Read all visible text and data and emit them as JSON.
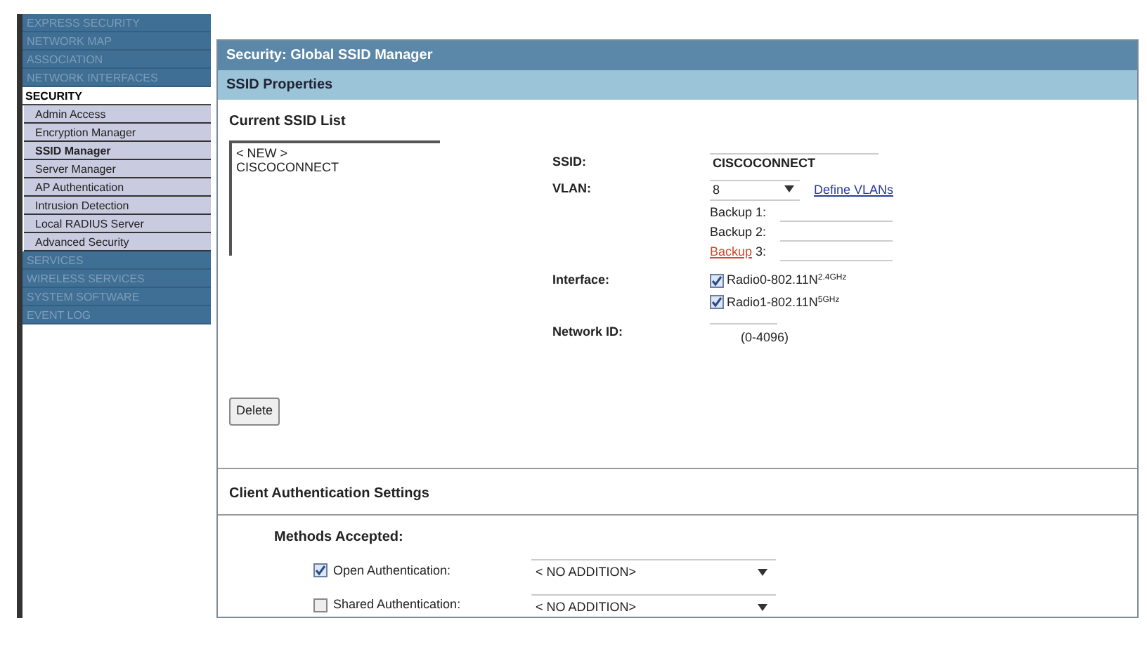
{
  "sidebar": {
    "items": [
      {
        "label": "EXPRESS SECURITY",
        "kind": "section",
        "selected": false
      },
      {
        "label": "NETWORK MAP",
        "kind": "section",
        "selected": false
      },
      {
        "label": "ASSOCIATION",
        "kind": "section",
        "selected": false
      },
      {
        "label": "NETWORK INTERFACES",
        "kind": "section",
        "selected": false
      },
      {
        "label": "SECURITY",
        "kind": "header",
        "selected": false
      },
      {
        "label": "Admin Access",
        "kind": "sub",
        "selected": false
      },
      {
        "label": "Encryption Manager",
        "kind": "sub",
        "selected": false
      },
      {
        "label": "SSID Manager",
        "kind": "sub",
        "selected": true
      },
      {
        "label": "Server Manager",
        "kind": "sub",
        "selected": false
      },
      {
        "label": "AP Authentication",
        "kind": "sub",
        "selected": false
      },
      {
        "label": "Intrusion Detection",
        "kind": "sub",
        "selected": false
      },
      {
        "label": "Local RADIUS Server",
        "kind": "sub",
        "selected": false
      },
      {
        "label": "Advanced Security",
        "kind": "sub",
        "selected": false
      },
      {
        "label": "SERVICES",
        "kind": "section",
        "selected": false
      },
      {
        "label": "WIRELESS SERVICES",
        "kind": "section",
        "selected": false
      },
      {
        "label": "SYSTEM SOFTWARE",
        "kind": "section",
        "selected": false
      },
      {
        "label": "EVENT LOG",
        "kind": "section",
        "selected": false
      }
    ]
  },
  "page_title": "Security: Global SSID Manager",
  "section_title": "SSID Properties",
  "ssid_list": {
    "title": "Current SSID List",
    "items": [
      "< NEW >",
      "CISCOCONNECT"
    ]
  },
  "ssid": {
    "label": "SSID:",
    "value": "CISCOCONNECT"
  },
  "vlan": {
    "label": "VLAN:",
    "value": "8",
    "link": "Define VLANs"
  },
  "backups": [
    {
      "label": "Backup 1:"
    },
    {
      "label": "Backup 2:"
    },
    {
      "label": "**Backup** 3:"
    }
  ],
  "interface": {
    "label": "Interface:",
    "options": [
      {
        "label": "Radio0-802.11N$^{2.4GHz}$",
        "checked": true
      },
      {
        "label": "Radio1-802.11N$^{5GHz}$",
        "checked": true
      }
    ]
  },
  "network_id": {
    "label": "Network ID:",
    "hint": "(0-4096)"
  },
  "delete_button": "Delete",
  "client_auth": {
    "title": "Client Authentication Settings",
    "methods_label": "Methods Accepted:",
    "methods": [
      {
        "label": "Open Authentication:",
        "checked": true,
        "value": "< NO ADDITION>"
      },
      {
        "label": "Shared Authentication:",
        "checked": false,
        "value": "< NO ADDITION>"
      }
    ]
  }
}
